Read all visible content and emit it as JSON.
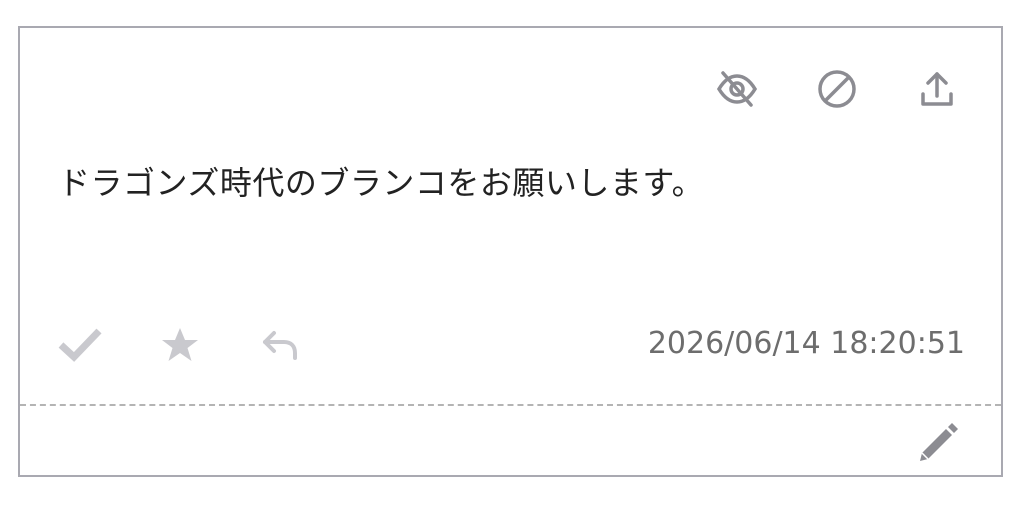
{
  "message": {
    "text": "ドラゴンズ時代のブランコをお願いします。"
  },
  "meta": {
    "timestamp": "2026/06/14 18:20:51"
  },
  "icons": {
    "hide": "eye-slash-icon",
    "block": "ban-icon",
    "share": "upload-icon",
    "check": "check-icon",
    "star": "star-icon",
    "reply": "reply-icon",
    "edit": "pencil-icon"
  },
  "colors": {
    "top_icon": "#8c8c92",
    "action_icon": "#c9c9ce",
    "timestamp": "#6d6d6d",
    "border": "#a9a9b1",
    "edit_icon": "#8c8c92"
  }
}
